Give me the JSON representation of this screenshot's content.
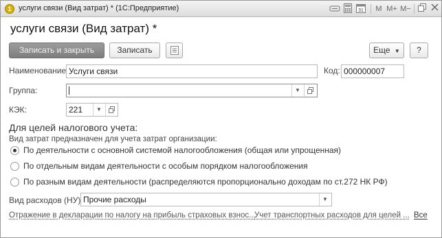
{
  "window": {
    "title": "услуги связи (Вид затрат) * (1С:Предприятие)",
    "toolbar_buttons": [
      "M",
      "M+",
      "M−"
    ]
  },
  "form": {
    "heading": "услуги связи (Вид затрат) *",
    "buttons": {
      "save_close": "Записать и закрыть",
      "save": "Записать",
      "more": "Еще",
      "help": "?"
    },
    "fields": {
      "name_label": "Наименование:",
      "name_value": "Услуги связи",
      "code_label": "Код:",
      "code_value": "000000007",
      "group_label": "Группа:",
      "group_value": "",
      "kek_label": "КЭК:",
      "kek_value": "221"
    },
    "tax": {
      "section_title": "Для целей налогового учета:",
      "subtitle": "Вид затрат предназначен для учета затрат организации:",
      "options": [
        "По деятельности с основной системой налогообложения (общая или упрощенная)",
        "По отдельным видам деятельности с особым порядком налогообложения",
        "По разным видам деятельности (распределяются пропорционально доходам по ст.272 НК РФ)"
      ],
      "selected_index": 0,
      "expense_label": "Вид расходов (НУ):",
      "expense_value": "Прочие расходы"
    },
    "links": {
      "declaration": "Отражение в декларации по налогу на прибыль страховых взнос...",
      "transport": "Учет транспортных расходов для целей ...",
      "all": "Все"
    }
  }
}
